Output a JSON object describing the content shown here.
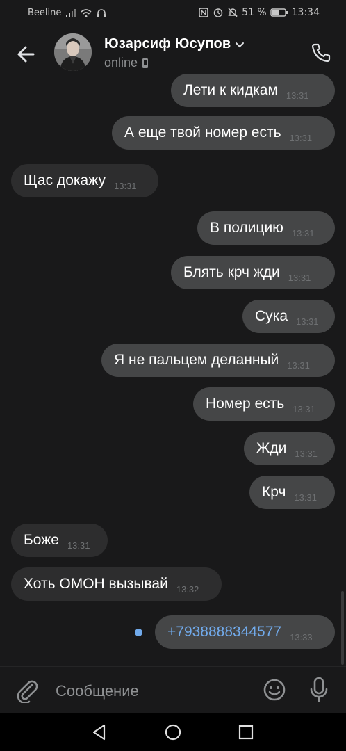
{
  "status_bar": {
    "carrier": "Beeline",
    "battery": "51 %",
    "time": "13:34"
  },
  "header": {
    "contact_name": "Юзарсиф Юсупов",
    "status": "online"
  },
  "messages": [
    {
      "text": "Лети к кидкам",
      "time": "13:31",
      "direction": "out"
    },
    {
      "text": "А еще твой номер есть",
      "time": "13:31",
      "direction": "out"
    },
    {
      "text": "Щас докажу",
      "time": "13:31",
      "direction": "in"
    },
    {
      "text": "В полицию",
      "time": "13:31",
      "direction": "out"
    },
    {
      "text": "Блять крч жди",
      "time": "13:31",
      "direction": "out"
    },
    {
      "text": "Сука",
      "time": "13:31",
      "direction": "out"
    },
    {
      "text": "Я не пальцем деланный",
      "time": "13:31",
      "direction": "out"
    },
    {
      "text": "Номер есть",
      "time": "13:31",
      "direction": "out"
    },
    {
      "text": "Жди",
      "time": "13:31",
      "direction": "out"
    },
    {
      "text": "Крч",
      "time": "13:31",
      "direction": "out"
    },
    {
      "text": "Боже",
      "time": "13:31",
      "direction": "in"
    },
    {
      "text": "Хоть ОМОН вызывай",
      "time": "13:32",
      "direction": "in"
    },
    {
      "text": "+7938888344577",
      "time": "13:33",
      "direction": "out",
      "is_link": true,
      "unread": true
    }
  ],
  "composer": {
    "placeholder": "Сообщение"
  },
  "colors": {
    "background": "#19191a",
    "outgoing_bubble": "#454647",
    "incoming_bubble": "#2d2d2e",
    "link": "#71aaeb"
  }
}
